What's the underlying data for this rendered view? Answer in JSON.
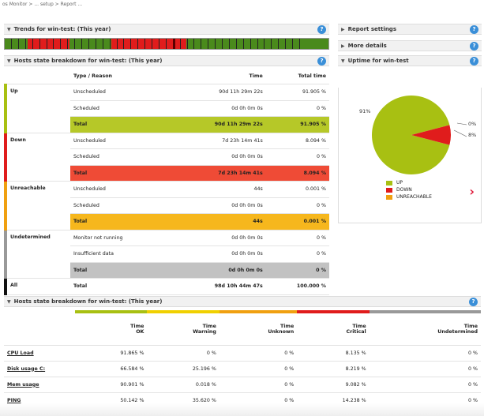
{
  "breadcrumb": "os Monitor > ... setup > Report ...",
  "trends": {
    "title": "Trends for win-test: (This year)"
  },
  "side_panels": {
    "report_settings": "Report settings",
    "more_details": "More details"
  },
  "hosts_state": {
    "title": "Hosts state breakdown for win-test: (This year)",
    "headers": [
      "Type / Reason",
      "Time",
      "Total time"
    ],
    "groups": [
      {
        "name": "Up",
        "color": "#a8c012",
        "rows": [
          [
            "Unscheduled",
            "90d 11h 29m 22s",
            "91.905 %"
          ],
          [
            "Scheduled",
            "0d 0h 0m 0s",
            "0 %"
          ]
        ],
        "total": [
          "Total",
          "90d 11h 29m 22s",
          "91.905 %"
        ],
        "total_bg": "#b6c828"
      },
      {
        "name": "Down",
        "color": "#e01c1c",
        "rows": [
          [
            "Unscheduled",
            "7d 23h 14m 41s",
            "8.094 %"
          ],
          [
            "Scheduled",
            "0d 0h 0m 0s",
            "0 %"
          ]
        ],
        "total": [
          "Total",
          "7d 23h 14m 41s",
          "8.094 %"
        ],
        "total_bg": "#ef4b36"
      },
      {
        "name": "Unreachable",
        "color": "#f0a010",
        "rows": [
          [
            "Unscheduled",
            "44s",
            "0.001 %"
          ],
          [
            "Scheduled",
            "0d 0h 0m 0s",
            "0 %"
          ]
        ],
        "total": [
          "Total",
          "44s",
          "0.001 %"
        ],
        "total_bg": "#f6b71d"
      },
      {
        "name": "Undetermined",
        "color": "#999999",
        "rows": [
          [
            "Monitor not running",
            "0d 0h 0m 0s",
            "0 %"
          ],
          [
            "Insufficient data",
            "0d 0h 0m 0s",
            "0 %"
          ]
        ],
        "total": [
          "Total",
          "0d 0h 0m 0s",
          "0 %"
        ],
        "total_bg": "#c2c2c2"
      },
      {
        "name": "All",
        "color": "#111111",
        "rows": [],
        "total": [
          "Total",
          "98d 10h 44m 47s",
          "100.000 %"
        ],
        "total_bg": "#ffffff"
      }
    ]
  },
  "uptime": {
    "title": "Uptime for win-test",
    "labels": {
      "up": "91%",
      "unreach": "0%",
      "down": "8%"
    },
    "legend": [
      "UP",
      "DOWN",
      "UNREACHABLE"
    ],
    "colors": {
      "up": "#a8c012",
      "down": "#e01c1c",
      "unreach": "#f0a010"
    }
  },
  "chart_data": {
    "type": "pie",
    "title": "Uptime for win-test",
    "categories": [
      "UP",
      "DOWN",
      "UNREACHABLE"
    ],
    "values": [
      91.905,
      8.094,
      0.001
    ],
    "labels": [
      "91%",
      "8%",
      "0%"
    ],
    "colors": [
      "#a8c012",
      "#e01c1c",
      "#f0a010"
    ]
  },
  "services_state": {
    "title": "Hosts state breakdown for win-test: (This year)",
    "headers": [
      [
        "Time",
        "OK"
      ],
      [
        "Time",
        "Warning"
      ],
      [
        "Time",
        "Unknown"
      ],
      [
        "Time",
        "Critical"
      ],
      [
        "Time",
        "Undetermined"
      ]
    ],
    "header_colors": [
      "#a8c012",
      "#f0d000",
      "#f0a010",
      "#e01c1c",
      "#999999"
    ],
    "rows": [
      {
        "name": "CPU Load",
        "values": [
          "91.865 %",
          "0 %",
          "0 %",
          "8.135 %",
          "0 %"
        ]
      },
      {
        "name": "Disk usage C:",
        "values": [
          "66.584 %",
          "25.196 %",
          "0 %",
          "8.219 %",
          "0 %"
        ]
      },
      {
        "name": "Mem usage",
        "values": [
          "90.901 %",
          "0.018 %",
          "0 %",
          "9.082 %",
          "0 %"
        ]
      },
      {
        "name": "PING",
        "values": [
          "50.142 %",
          "35.620 %",
          "0 %",
          "14.238 %",
          "0 %"
        ]
      }
    ]
  }
}
